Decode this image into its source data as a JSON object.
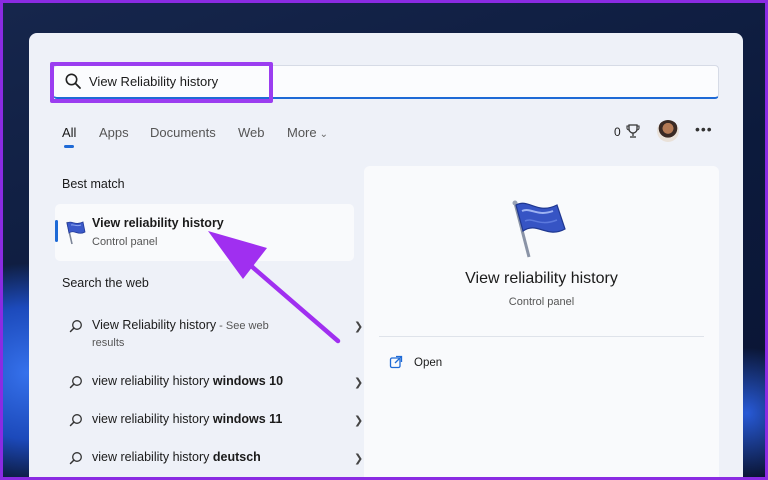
{
  "search": {
    "query": "View Reliability history"
  },
  "tabs": [
    {
      "label": "All",
      "active": true
    },
    {
      "label": "Apps"
    },
    {
      "label": "Documents"
    },
    {
      "label": "Web"
    },
    {
      "label": "More"
    }
  ],
  "toolbar": {
    "points": "0",
    "icons": [
      "trophy-icon",
      "avatar",
      "more-icon"
    ]
  },
  "best_match": {
    "section_label": "Best match",
    "title": "View reliability history",
    "subtitle": "Control panel"
  },
  "web": {
    "section_label": "Search the web",
    "results": [
      {
        "text": "View Reliability history",
        "note": " - See web",
        "note2": "results"
      },
      {
        "prefix": "view reliability history ",
        "bold": "windows 10"
      },
      {
        "prefix": "view reliability history ",
        "bold": "windows 11"
      },
      {
        "prefix": "view reliability history ",
        "bold": "deutsch"
      }
    ]
  },
  "detail": {
    "title": "View reliability history",
    "subtitle": "Control panel",
    "actions": [
      {
        "label": "Open",
        "icon": "open-external-icon"
      }
    ]
  },
  "colors": {
    "accent": "#1e6ad6",
    "highlight": "#9b3df0",
    "panel_bg": "#eef1f8",
    "frame_border": "#8a2be2"
  }
}
